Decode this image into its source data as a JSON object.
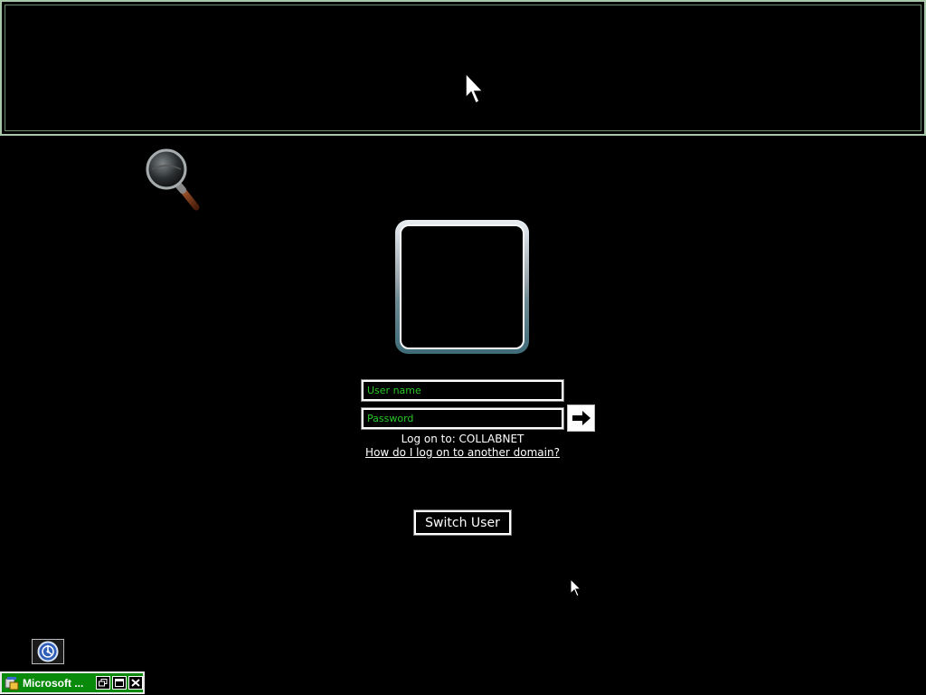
{
  "login": {
    "username_placeholder": "User name",
    "password_placeholder": "Password",
    "logon_to": "Log on to: COLLABNET",
    "domain_link": "How do I log on to another domain?",
    "switch_user_label": "Switch User"
  },
  "taskbar": {
    "window_title": "Microsoft ..."
  },
  "icons": {
    "magnifier": "magnifier-icon",
    "submit": "arrow-right-icon",
    "ease_of_access": "ease-of-access-icon",
    "restore": "restore-icon",
    "maximize": "maximize-icon",
    "close": "close-icon"
  },
  "colors": {
    "background": "#000000",
    "field_text": "#28c828",
    "magnifier_border": "#a9c8a9",
    "taskbar_green": "#0a8a0a"
  }
}
